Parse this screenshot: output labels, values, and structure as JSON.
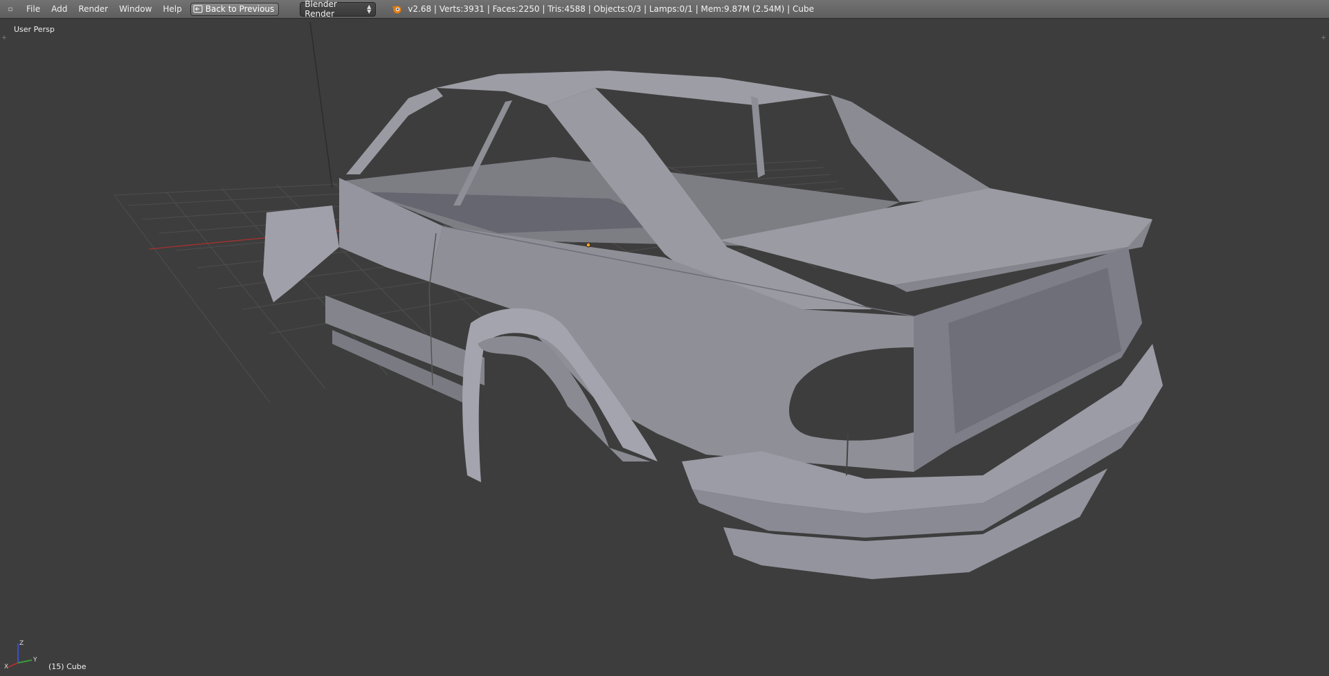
{
  "topbar": {
    "editor_icon": "editor-type-icon",
    "menus": [
      "File",
      "Add",
      "Render",
      "Window",
      "Help"
    ],
    "back_button_label": "Back to Previous",
    "render_engine": "Blender Render",
    "stats": "v2.68 | Verts:3931 | Faces:2250 | Tris:4588 | Objects:0/3 | Lamps:0/1 | Mem:9.87M (2.54M) | Cube"
  },
  "viewport": {
    "view_name": "User Persp",
    "active_object": "(15) Cube",
    "axes": {
      "x": "X",
      "y": "Y",
      "z": "Z"
    }
  },
  "colors": {
    "background": "#3d3d3d",
    "mesh": "#8f8f96",
    "x_axis": "#b03030",
    "y_axis": "#3a9a3a",
    "z_axis": "#3a50c8"
  }
}
